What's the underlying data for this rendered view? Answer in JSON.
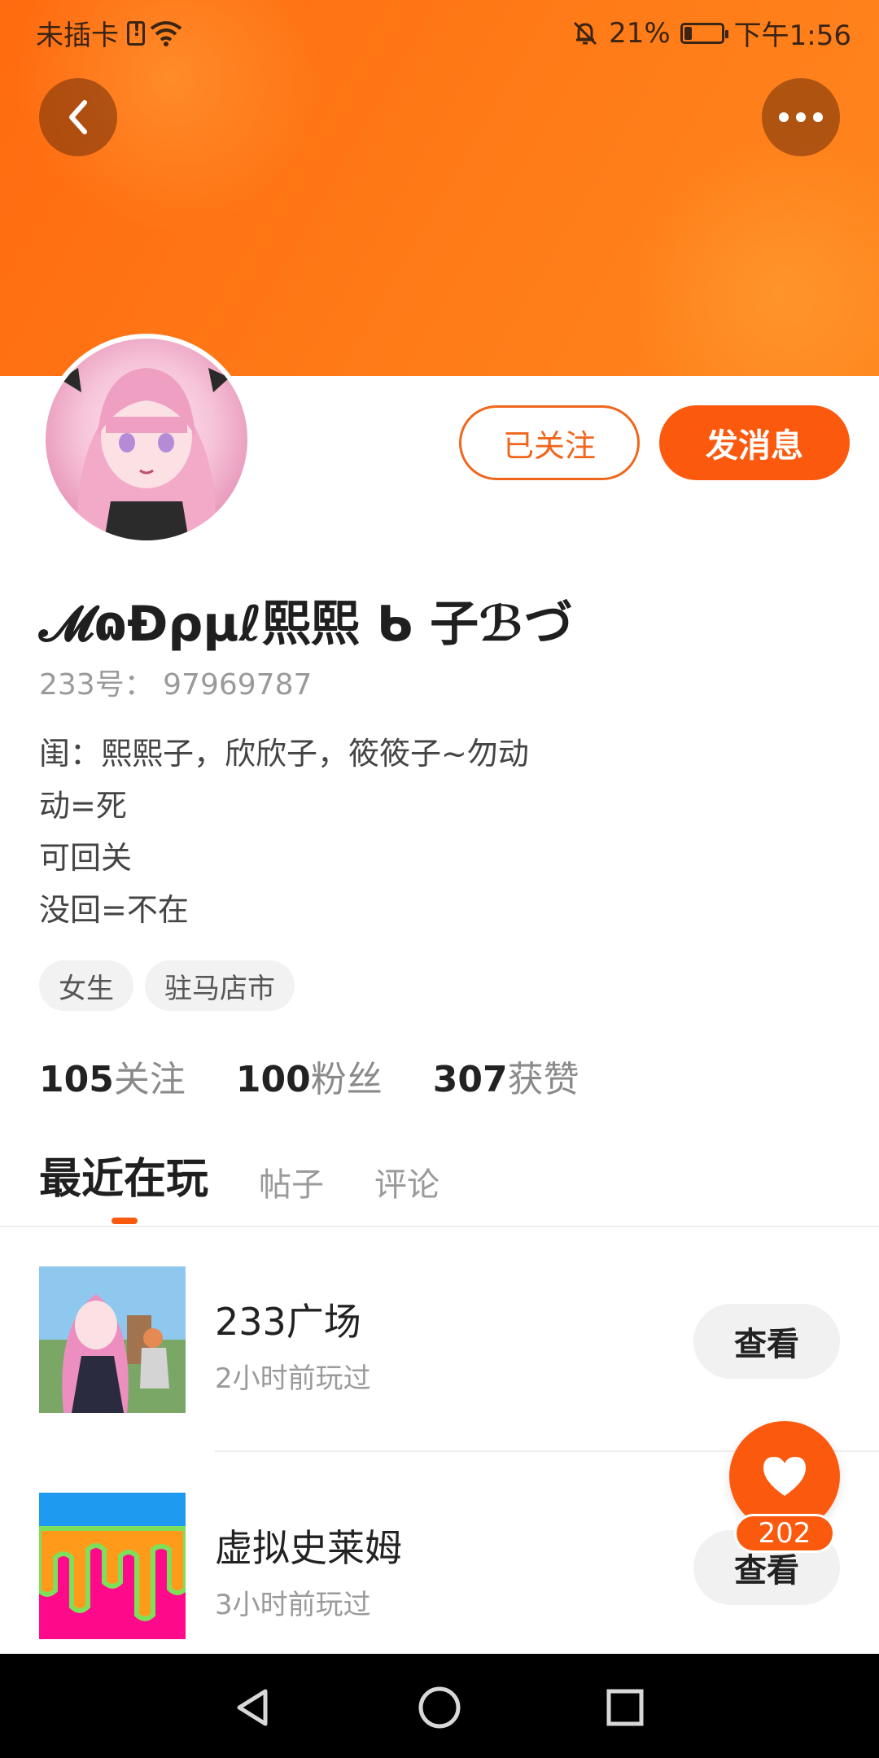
{
  "status_bar": {
    "carrier": "未插卡",
    "battery_percent": "21%",
    "battery_level": 0.21,
    "time": "下午1:56"
  },
  "header": {
    "back_icon": "chevron-left-icon",
    "more_icon": "more-dots-icon"
  },
  "profile": {
    "follow_label": "已关注",
    "message_label": "发消息",
    "name": "𝓜ɷÐρμℓ熙熙 ᑲ 子ℬづ",
    "uid": "233号：  97969787",
    "bio": [
      "闺：熙熙子，欣欣子，筱筱子~勿动",
      "动=死",
      "可回关",
      "没回=不在"
    ],
    "tags": [
      "女生",
      "驻马店市"
    ]
  },
  "stats": [
    {
      "num": "105",
      "label": "关注"
    },
    {
      "num": "100",
      "label": "粉丝"
    },
    {
      "num": "307",
      "label": "获赞"
    }
  ],
  "tabs": [
    {
      "label": "最近在玩",
      "active": true
    },
    {
      "label": "帖子",
      "active": false
    },
    {
      "label": "评论",
      "active": false
    }
  ],
  "games": [
    {
      "title": "233广场",
      "subtitle": "2小时前玩过",
      "button": "查看"
    },
    {
      "title": "虚拟史莱姆",
      "subtitle": "3小时前玩过",
      "button": "查看"
    }
  ],
  "like_fab": {
    "count": "202",
    "icon": "heart-icon"
  },
  "colors": {
    "accent": "#fb5a0e",
    "header": "#ff7a18"
  }
}
